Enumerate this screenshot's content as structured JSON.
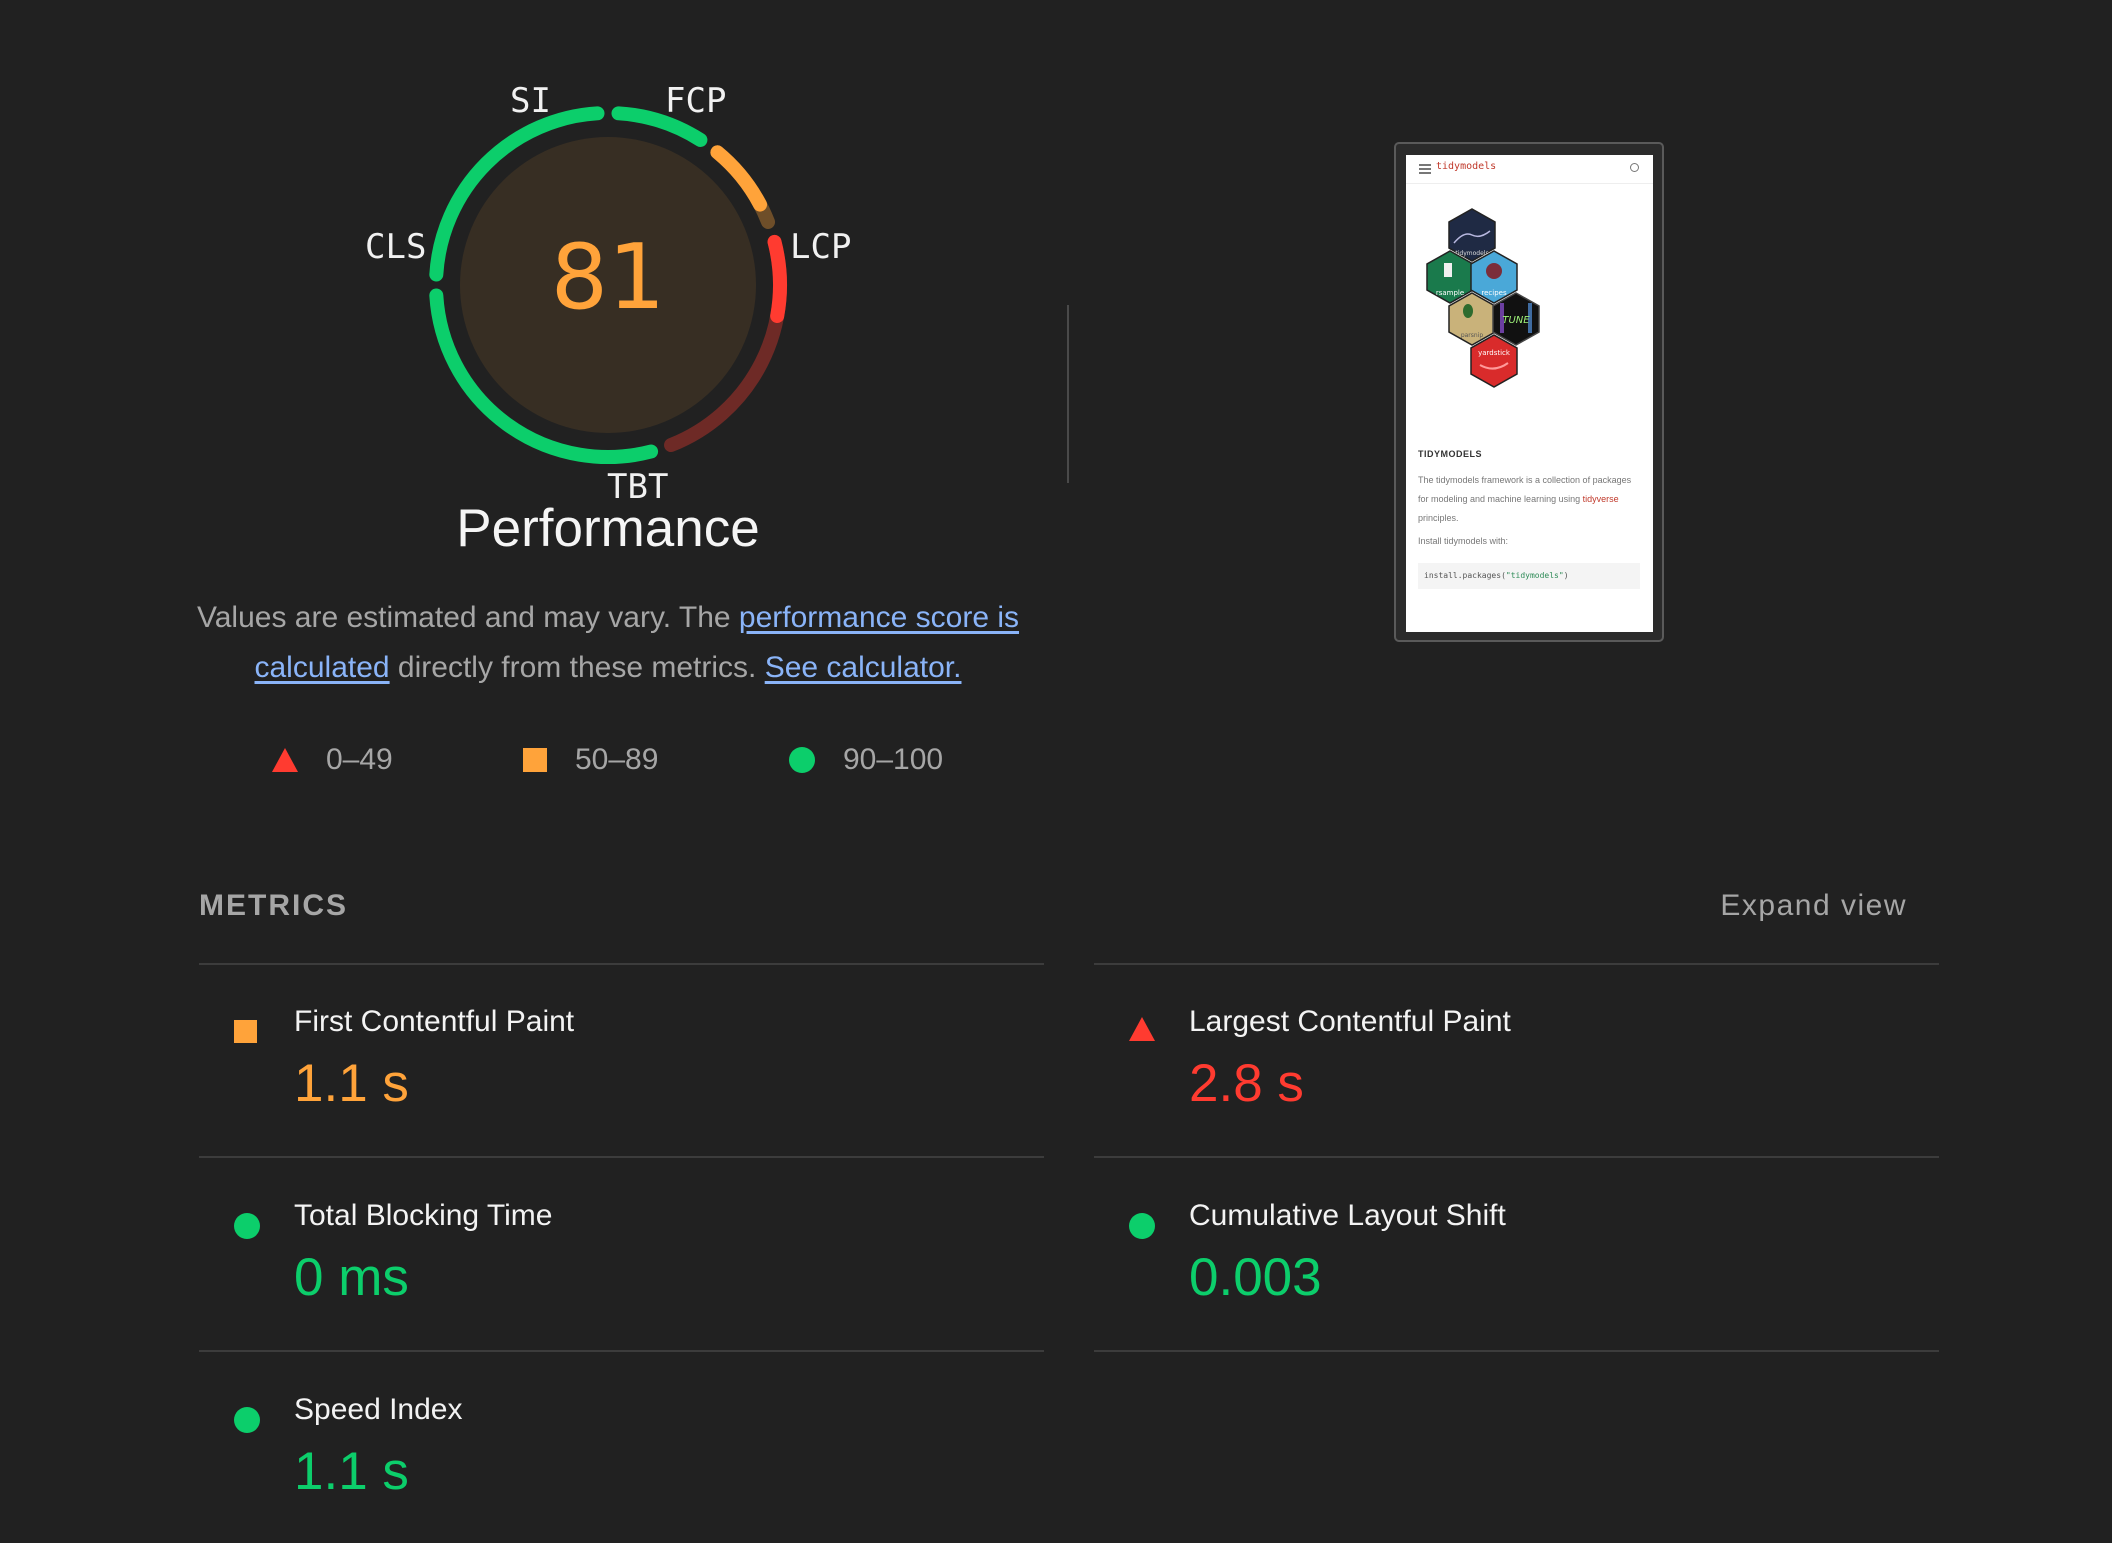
{
  "colors": {
    "fail": "#ff3b30",
    "average": "#ffa33a",
    "pass": "#0cce6b",
    "link": "#8ab4f8"
  },
  "gauge": {
    "score": "81",
    "segments": [
      {
        "id": "SI",
        "label": "SI",
        "weight": 10,
        "score": 1.0,
        "rating": "pass"
      },
      {
        "id": "FCP",
        "label": "FCP",
        "weight": 10,
        "score": 0.78,
        "rating": "average"
      },
      {
        "id": "LCP",
        "label": "LCP",
        "weight": 25,
        "score": 0.3,
        "rating": "fail"
      },
      {
        "id": "TBT",
        "label": "TBT",
        "weight": 30,
        "score": 1.0,
        "rating": "pass"
      },
      {
        "id": "CLS",
        "label": "CLS",
        "weight": 25,
        "score": 1.0,
        "rating": "pass"
      }
    ],
    "title": "Performance"
  },
  "description": {
    "prefix": "Values are estimated and may vary. The ",
    "link1": "performance score is calculated",
    "middle": " directly from these metrics. ",
    "link2": "See calculator."
  },
  "legend": [
    {
      "shape": "triangle",
      "range": "0–49"
    },
    {
      "shape": "square",
      "range": "50–89"
    },
    {
      "shape": "circle",
      "range": "90–100"
    }
  ],
  "screenshot": {
    "brand": "tidymodels",
    "hex_labels": [
      "tidymodels",
      "rsample",
      "recipes",
      "parsnip",
      "TUNE",
      "yardstick"
    ],
    "heading": "TIDYMODELS",
    "text_before": "The tidymodels framework is a collection of packages for modeling and machine learning using ",
    "text_link": "tidyverse",
    "text_after": " principles.",
    "install_label": "Install tidymodels with:",
    "code_fn": "install.packages(",
    "code_str": "\"tidymodels\"",
    "code_end": ")"
  },
  "metrics": {
    "title": "METRICS",
    "expand_label": "Expand view",
    "items": [
      {
        "label": "First Contentful Paint",
        "value": "1.1 s",
        "rating": "average"
      },
      {
        "label": "Largest Contentful Paint",
        "value": "2.8 s",
        "rating": "fail"
      },
      {
        "label": "Total Blocking Time",
        "value": "0 ms",
        "rating": "pass"
      },
      {
        "label": "Cumulative Layout Shift",
        "value": "0.003",
        "rating": "pass"
      },
      {
        "label": "Speed Index",
        "value": "1.1 s",
        "rating": "pass"
      }
    ]
  }
}
